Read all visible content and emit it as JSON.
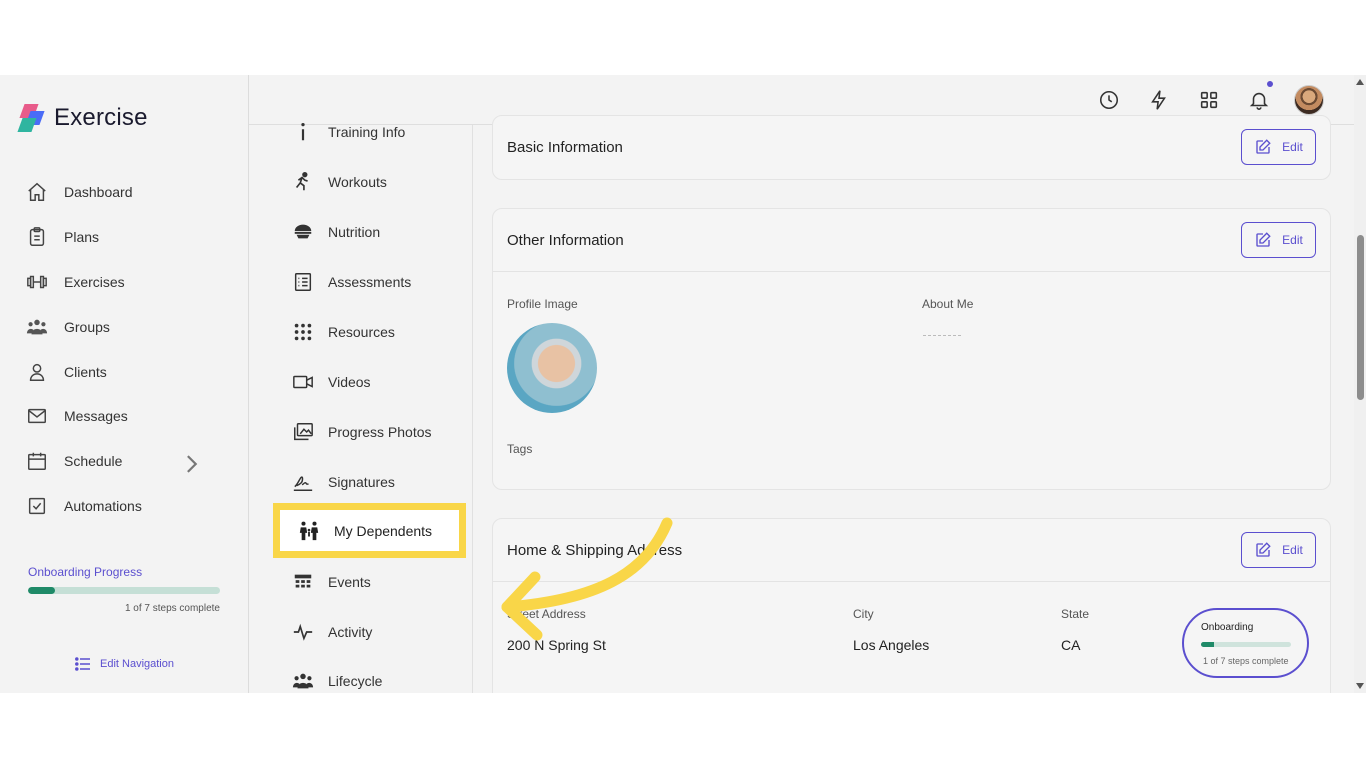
{
  "app": {
    "name": "Exercise"
  },
  "sidebar": {
    "items": [
      {
        "label": "Dashboard",
        "icon": "home-icon"
      },
      {
        "label": "Plans",
        "icon": "clipboard-icon"
      },
      {
        "label": "Exercises",
        "icon": "dumbbell-icon"
      },
      {
        "label": "Groups",
        "icon": "groups-icon"
      },
      {
        "label": "Clients",
        "icon": "user-icon"
      },
      {
        "label": "Messages",
        "icon": "mail-icon"
      },
      {
        "label": "Schedule",
        "icon": "calendar-icon"
      },
      {
        "label": "Automations",
        "icon": "checkbox-icon"
      }
    ],
    "onboarding": {
      "title": "Onboarding Progress",
      "steps": "1 of 7 steps complete",
      "progress": 0.14
    },
    "edit_nav": "Edit Navigation"
  },
  "submenu": {
    "items": [
      {
        "label": "Training Info",
        "icon": "info-icon"
      },
      {
        "label": "Workouts",
        "icon": "running-icon"
      },
      {
        "label": "Nutrition",
        "icon": "bowl-icon"
      },
      {
        "label": "Assessments",
        "icon": "list-icon"
      },
      {
        "label": "Resources",
        "icon": "grid-dots-icon"
      },
      {
        "label": "Videos",
        "icon": "video-icon"
      },
      {
        "label": "Progress Photos",
        "icon": "photos-icon"
      },
      {
        "label": "Signatures",
        "icon": "signature-icon"
      },
      {
        "label": "My Dependents",
        "icon": "family-icon"
      },
      {
        "label": "Events",
        "icon": "calendar-grid-icon"
      },
      {
        "label": "Activity",
        "icon": "pulse-icon"
      },
      {
        "label": "Lifecycle",
        "icon": "people-icon"
      }
    ]
  },
  "main": {
    "basic": {
      "title": "Basic Information",
      "edit": "Edit"
    },
    "other": {
      "title": "Other Information",
      "edit": "Edit",
      "profile_image_label": "Profile Image",
      "about_label": "About Me",
      "tags_label": "Tags"
    },
    "address": {
      "title": "Home & Shipping Address",
      "edit": "Edit",
      "street_label": "Street Address",
      "street": "200 N Spring St",
      "city_label": "City",
      "city": "Los Angeles",
      "state_label": "State",
      "state": "CA"
    }
  },
  "onboarding_popup": {
    "title": "Onboarding",
    "steps": "1 of 7 steps complete",
    "progress": 0.14
  },
  "colors": {
    "accent": "#5b4fcf",
    "highlight": "#f9d648",
    "progress": "#1f8a68"
  }
}
